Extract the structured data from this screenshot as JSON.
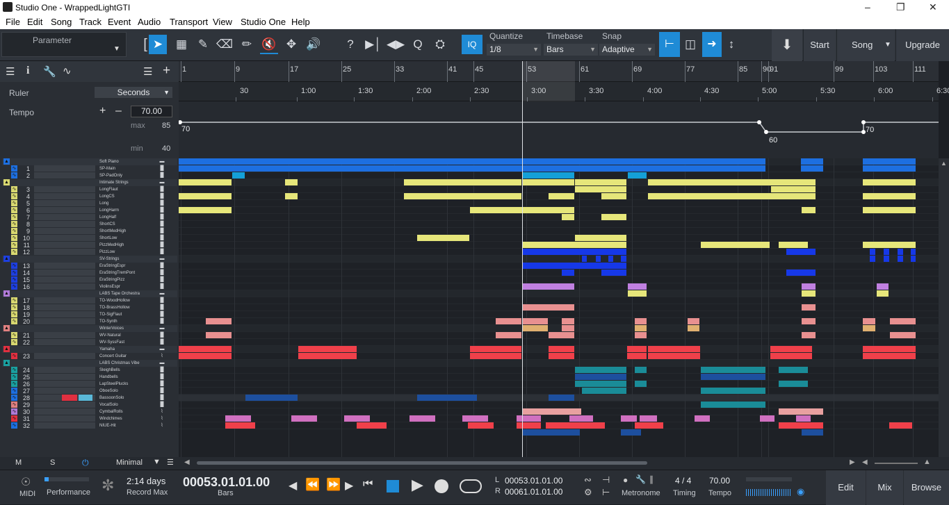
{
  "window": {
    "title": "Studio One - WrappedLightGTI"
  },
  "menu": [
    "File",
    "Edit",
    "Song",
    "Track",
    "Event",
    "Audio",
    "Transport",
    "View",
    "Studio One",
    "Help"
  ],
  "toolbar": {
    "parameter_label": "Parameter",
    "quantize_label": "Quantize",
    "quantize_value": "1/8",
    "timebase_label": "Timebase",
    "timebase_value": "Bars",
    "snap_label": "Snap",
    "snap_value": "Adaptive",
    "iq_label": "IQ",
    "start_label": "Start",
    "song_label": "Song",
    "upgrade_label": "Upgrade"
  },
  "inspector": {
    "ruler_label": "Ruler",
    "ruler_value": "Seconds",
    "tempo_label": "Tempo",
    "tempo_value": "70.00",
    "max_label": "max",
    "max_value": "85",
    "min_label": "min",
    "min_value": "40"
  },
  "ruler": {
    "bars": [
      "1",
      "9",
      "17",
      "25",
      "33",
      "41",
      "45",
      "53",
      "61",
      "69",
      "77",
      "85",
      "90",
      "91",
      "99",
      "103",
      "111"
    ],
    "times": [
      "30",
      "1:00",
      "1:30",
      "2:00",
      "2:30",
      "3:00",
      "3:30",
      "4:00",
      "4:30",
      "5:00",
      "5:30",
      "6:00",
      "6:30"
    ],
    "tempo_points": [
      "70",
      "60",
      "70"
    ]
  },
  "tracks": [
    {
      "num": "",
      "name": "Soft Piano",
      "folder": true,
      "color": "#1d6fe0"
    },
    {
      "num": "1",
      "name": "SP-Main",
      "color": "#1d6fe0",
      "icon": "m"
    },
    {
      "num": "2",
      "name": "SP-PadOnly",
      "color": "#1d6fe0",
      "icon": "m"
    },
    {
      "num": "",
      "name": "Intimate Strings",
      "folder": true,
      "color": "#d8d870"
    },
    {
      "num": "3",
      "name": "LongFlaut",
      "color": "#d8d870",
      "icon": "m"
    },
    {
      "num": "4",
      "name": "LongCS",
      "color": "#d8d870",
      "icon": "m"
    },
    {
      "num": "5",
      "name": "Long",
      "color": "#d8d870",
      "icon": "m"
    },
    {
      "num": "6",
      "name": "LongHarm",
      "color": "#d8d870",
      "icon": "m"
    },
    {
      "num": "7",
      "name": "LongHalf",
      "color": "#d8d870",
      "icon": "m"
    },
    {
      "num": "8",
      "name": "ShortCS",
      "color": "#d8d870",
      "icon": "m"
    },
    {
      "num": "9",
      "name": "ShortMedHigh",
      "color": "#d8d870",
      "icon": "m"
    },
    {
      "num": "10",
      "name": "ShortLow",
      "color": "#d8d870",
      "icon": "m"
    },
    {
      "num": "11",
      "name": "PizzMedHigh",
      "color": "#d8d870",
      "icon": "m"
    },
    {
      "num": "12",
      "name": "PizzLow",
      "color": "#d8d870",
      "icon": "m"
    },
    {
      "num": "",
      "name": "SV-Strings",
      "folder": true,
      "color": "#1d3fe0"
    },
    {
      "num": "13",
      "name": "EraStringEspr",
      "color": "#1d3fe0",
      "icon": "m"
    },
    {
      "num": "14",
      "name": "EraStringTremPont",
      "color": "#1d3fe0",
      "icon": "m"
    },
    {
      "num": "15",
      "name": "EraStringPizz",
      "color": "#1d3fe0",
      "icon": "m"
    },
    {
      "num": "16",
      "name": "ViolinsEspr",
      "color": "#1d3fe0",
      "icon": "m"
    },
    {
      "num": "",
      "name": "LABS Tape Orchestra",
      "folder": true,
      "color": "#b07ad8"
    },
    {
      "num": "17",
      "name": "TO-WoodHollow",
      "color": "#d8d870",
      "icon": "m"
    },
    {
      "num": "18",
      "name": "TO-BrassHollow",
      "color": "#d8d870",
      "icon": "m"
    },
    {
      "num": "19",
      "name": "TO-SigFlaut",
      "color": "#d8d870",
      "icon": "m"
    },
    {
      "num": "20",
      "name": "TO-Synth",
      "color": "#d8d870",
      "icon": "m"
    },
    {
      "num": "",
      "name": "WinterVoices",
      "folder": true,
      "color": "#e08080"
    },
    {
      "num": "21",
      "name": "WV-Natural",
      "color": "#d8d870",
      "icon": "m"
    },
    {
      "num": "22",
      "name": "WV-SyssFast",
      "color": "#d8d870",
      "icon": "m"
    },
    {
      "num": "",
      "name": "Yamaha",
      "folder": true,
      "color": "#e03040"
    },
    {
      "num": "23",
      "name": "Concert Guitar",
      "color": "#e03040",
      "icon": "w"
    },
    {
      "num": "",
      "name": "LABS Christmas Vibe",
      "folder": true,
      "color": "#1aa0a0"
    },
    {
      "num": "24",
      "name": "SleighBells",
      "color": "#1aa0a0",
      "icon": "m"
    },
    {
      "num": "25",
      "name": "Handbells",
      "color": "#1aa0a0",
      "icon": "m"
    },
    {
      "num": "26",
      "name": "LapSteelPlucks",
      "color": "#1aa0a0",
      "icon": "m"
    },
    {
      "num": "27",
      "name": "OboeSolo",
      "color": "#1d6fe0",
      "icon": "m"
    },
    {
      "num": "28",
      "name": "BassoonSolo",
      "color": "#1d6fe0",
      "icon": "m"
    },
    {
      "num": "29",
      "name": "VocalSolo",
      "color": "#e08080",
      "icon": "m"
    },
    {
      "num": "30",
      "name": "CymbalRolls",
      "color": "#b07ad8",
      "icon": "w"
    },
    {
      "num": "31",
      "name": "Windchimes",
      "color": "#e03040",
      "icon": "w"
    },
    {
      "num": "32",
      "name": "NIUE-Hit",
      "color": "#1d6fe0",
      "icon": "w"
    }
  ],
  "colors": {
    "blue": "#1d6fe0",
    "cyan": "#14a0d8",
    "yellow": "#e6e67a",
    "navy": "#1638e8",
    "violet": "#c080e0",
    "salmon": "#e89090",
    "red": "#f0404a",
    "teal": "#1a8c98",
    "darkblue": "#1d4f9e",
    "pink": "#e8a0a0",
    "magenta": "#d070c0"
  },
  "bottom": {
    "m": "M",
    "s": "S",
    "view_mode": "Minimal"
  },
  "transport": {
    "midi": "MIDI",
    "performance": "Performance",
    "record_days": "2:14 days",
    "record_label": "Record Max",
    "position": "00053.01.01.00",
    "position_unit": "Bars",
    "loop_l": "L",
    "loop_l_value": "00053.01.01.00",
    "loop_r": "R",
    "loop_r_value": "00061.01.01.00",
    "metronome": "Metronome",
    "timing_value": "4 / 4",
    "timing_label": "Timing",
    "tempo_value": "70.00",
    "tempo_label": "Tempo",
    "edit": "Edit",
    "mix": "Mix",
    "browse": "Browse"
  }
}
